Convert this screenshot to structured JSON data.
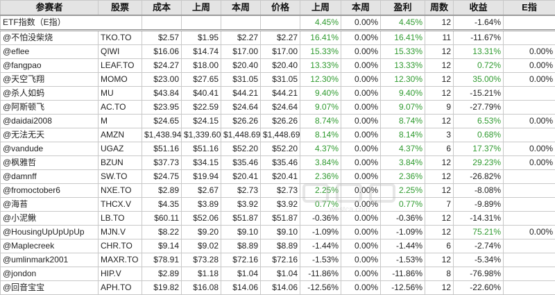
{
  "headers": [
    "参赛者",
    "股票",
    "成本",
    "上周",
    "本周",
    "价格",
    "上周",
    "本周",
    "盈利",
    "周数",
    "收益",
    "E指"
  ],
  "etf": {
    "label": "ETF指数（E指）",
    "last_week": "4.45%",
    "this_week": "0.00%",
    "profit": "4.45%",
    "weeks": "12",
    "return": "-1.64%"
  },
  "rows": [
    {
      "name": "@不怕没柴烧",
      "ticker": "TKO.TO",
      "cost": "$2.57",
      "last_price": "$1.95",
      "this_price": "$2.27",
      "price": "$2.27",
      "last_pct": "16.41%",
      "this_pct": "0.00%",
      "profit": "16.41%",
      "weeks": "11",
      "return": "-11.67%",
      "eidx": ""
    },
    {
      "name": "@eflee",
      "ticker": "QIWI",
      "cost": "$16.06",
      "last_price": "$14.74",
      "this_price": "$17.00",
      "price": "$17.00",
      "last_pct": "15.33%",
      "this_pct": "0.00%",
      "profit": "15.33%",
      "weeks": "12",
      "return": "13.31%",
      "eidx": "0.00%"
    },
    {
      "name": "@fangpao",
      "ticker": "LEAF.TO",
      "cost": "$24.27",
      "last_price": "$18.00",
      "this_price": "$20.40",
      "price": "$20.40",
      "last_pct": "13.33%",
      "this_pct": "0.00%",
      "profit": "13.33%",
      "weeks": "12",
      "return": "0.72%",
      "eidx": "0.00%"
    },
    {
      "name": "@天空飞翔",
      "ticker": "MOMO",
      "cost": "$23.00",
      "last_price": "$27.65",
      "this_price": "$31.05",
      "price": "$31.05",
      "last_pct": "12.30%",
      "this_pct": "0.00%",
      "profit": "12.30%",
      "weeks": "12",
      "return": "35.00%",
      "eidx": "0.00%"
    },
    {
      "name": "@杀人如蚂",
      "ticker": "MU",
      "cost": "$43.84",
      "last_price": "$40.41",
      "this_price": "$44.21",
      "price": "$44.21",
      "last_pct": "9.40%",
      "this_pct": "0.00%",
      "profit": "9.40%",
      "weeks": "12",
      "return": "-15.21%",
      "eidx": ""
    },
    {
      "name": "@阿斯顿飞",
      "ticker": "AC.TO",
      "cost": "$23.95",
      "last_price": "$22.59",
      "this_price": "$24.64",
      "price": "$24.64",
      "last_pct": "9.07%",
      "this_pct": "0.00%",
      "profit": "9.07%",
      "weeks": "9",
      "return": "-27.79%",
      "eidx": ""
    },
    {
      "name": "@daidai2008",
      "ticker": "M",
      "cost": "$24.65",
      "last_price": "$24.15",
      "this_price": "$26.26",
      "price": "$26.26",
      "last_pct": "8.74%",
      "this_pct": "0.00%",
      "profit": "8.74%",
      "weeks": "12",
      "return": "6.53%",
      "eidx": "0.00%"
    },
    {
      "name": "@无法无天",
      "ticker": "AMZN",
      "cost": "$1,438.94",
      "last_price": "$1,339.60",
      "this_price": "$1,448.69",
      "price": "$1,448.69",
      "last_pct": "8.14%",
      "this_pct": "0.00%",
      "profit": "8.14%",
      "weeks": "3",
      "return": "0.68%",
      "eidx": ""
    },
    {
      "name": "@vandude",
      "ticker": "UGAZ",
      "cost": "$51.16",
      "last_price": "$51.16",
      "this_price": "$52.20",
      "price": "$52.20",
      "last_pct": "4.37%",
      "this_pct": "0.00%",
      "profit": "4.37%",
      "weeks": "6",
      "return": "17.37%",
      "eidx": "0.00%"
    },
    {
      "name": "@枫雅哲",
      "ticker": "BZUN",
      "cost": "$37.73",
      "last_price": "$34.15",
      "this_price": "$35.46",
      "price": "$35.46",
      "last_pct": "3.84%",
      "this_pct": "0.00%",
      "profit": "3.84%",
      "weeks": "12",
      "return": "29.23%",
      "eidx": "0.00%"
    },
    {
      "name": "@damnff",
      "ticker": "SW.TO",
      "cost": "$24.75",
      "last_price": "$19.94",
      "this_price": "$20.41",
      "price": "$20.41",
      "last_pct": "2.36%",
      "this_pct": "0.00%",
      "profit": "2.36%",
      "weeks": "12",
      "return": "-26.82%",
      "eidx": ""
    },
    {
      "name": "@fromoctober6",
      "ticker": "NXE.TO",
      "cost": "$2.89",
      "last_price": "$2.67",
      "this_price": "$2.73",
      "price": "$2.73",
      "last_pct": "2.25%",
      "this_pct": "0.00%",
      "profit": "2.25%",
      "weeks": "12",
      "return": "-8.08%",
      "eidx": ""
    },
    {
      "name": "@海苔",
      "ticker": "THCX.V",
      "cost": "$4.35",
      "last_price": "$3.89",
      "this_price": "$3.92",
      "price": "$3.92",
      "last_pct": "0.77%",
      "this_pct": "0.00%",
      "profit": "0.77%",
      "weeks": "7",
      "return": "-9.89%",
      "eidx": ""
    },
    {
      "name": "@小泥鳅",
      "ticker": "LB.TO",
      "cost": "$60.11",
      "last_price": "$52.06",
      "this_price": "$51.87",
      "price": "$51.87",
      "last_pct": "-0.36%",
      "this_pct": "0.00%",
      "profit": "-0.36%",
      "weeks": "12",
      "return": "-14.31%",
      "eidx": ""
    },
    {
      "name": "@HousingUpUpUpUp",
      "ticker": "MJN.V",
      "cost": "$8.22",
      "last_price": "$9.20",
      "this_price": "$9.10",
      "price": "$9.10",
      "last_pct": "-1.09%",
      "this_pct": "0.00%",
      "profit": "-1.09%",
      "weeks": "12",
      "return": "75.21%",
      "eidx": "0.00%"
    },
    {
      "name": "@Maplecreek",
      "ticker": "CHR.TO",
      "cost": "$9.14",
      "last_price": "$9.02",
      "this_price": "$8.89",
      "price": "$8.89",
      "last_pct": "-1.44%",
      "this_pct": "0.00%",
      "profit": "-1.44%",
      "weeks": "6",
      "return": "-2.74%",
      "eidx": ""
    },
    {
      "name": "@umlinmark2001",
      "ticker": "MAXR.TO",
      "cost": "$78.91",
      "last_price": "$73.28",
      "this_price": "$72.16",
      "price": "$72.16",
      "last_pct": "-1.53%",
      "this_pct": "0.00%",
      "profit": "-1.53%",
      "weeks": "12",
      "return": "-5.34%",
      "eidx": ""
    },
    {
      "name": "@jondon",
      "ticker": "HIP.V",
      "cost": "$2.89",
      "last_price": "$1.18",
      "this_price": "$1.04",
      "price": "$1.04",
      "last_pct": "-11.86%",
      "this_pct": "0.00%",
      "profit": "-11.86%",
      "weeks": "8",
      "return": "-76.98%",
      "eidx": ""
    },
    {
      "name": "@回音宝宝",
      "ticker": "APH.TO",
      "cost": "$19.82",
      "last_price": "$16.08",
      "this_price": "$14.06",
      "price": "$14.06",
      "last_pct": "-12.56%",
      "this_pct": "0.00%",
      "profit": "-12.56%",
      "weeks": "12",
      "return": "-22.60%",
      "eidx": ""
    }
  ],
  "watermark": {
    "text": "westca.com",
    "icon": "westca-logo-icon"
  },
  "colors": {
    "positive": "#2f9a2f",
    "header_bg": "#e4e4e4",
    "grid": "#c8c8c8"
  }
}
